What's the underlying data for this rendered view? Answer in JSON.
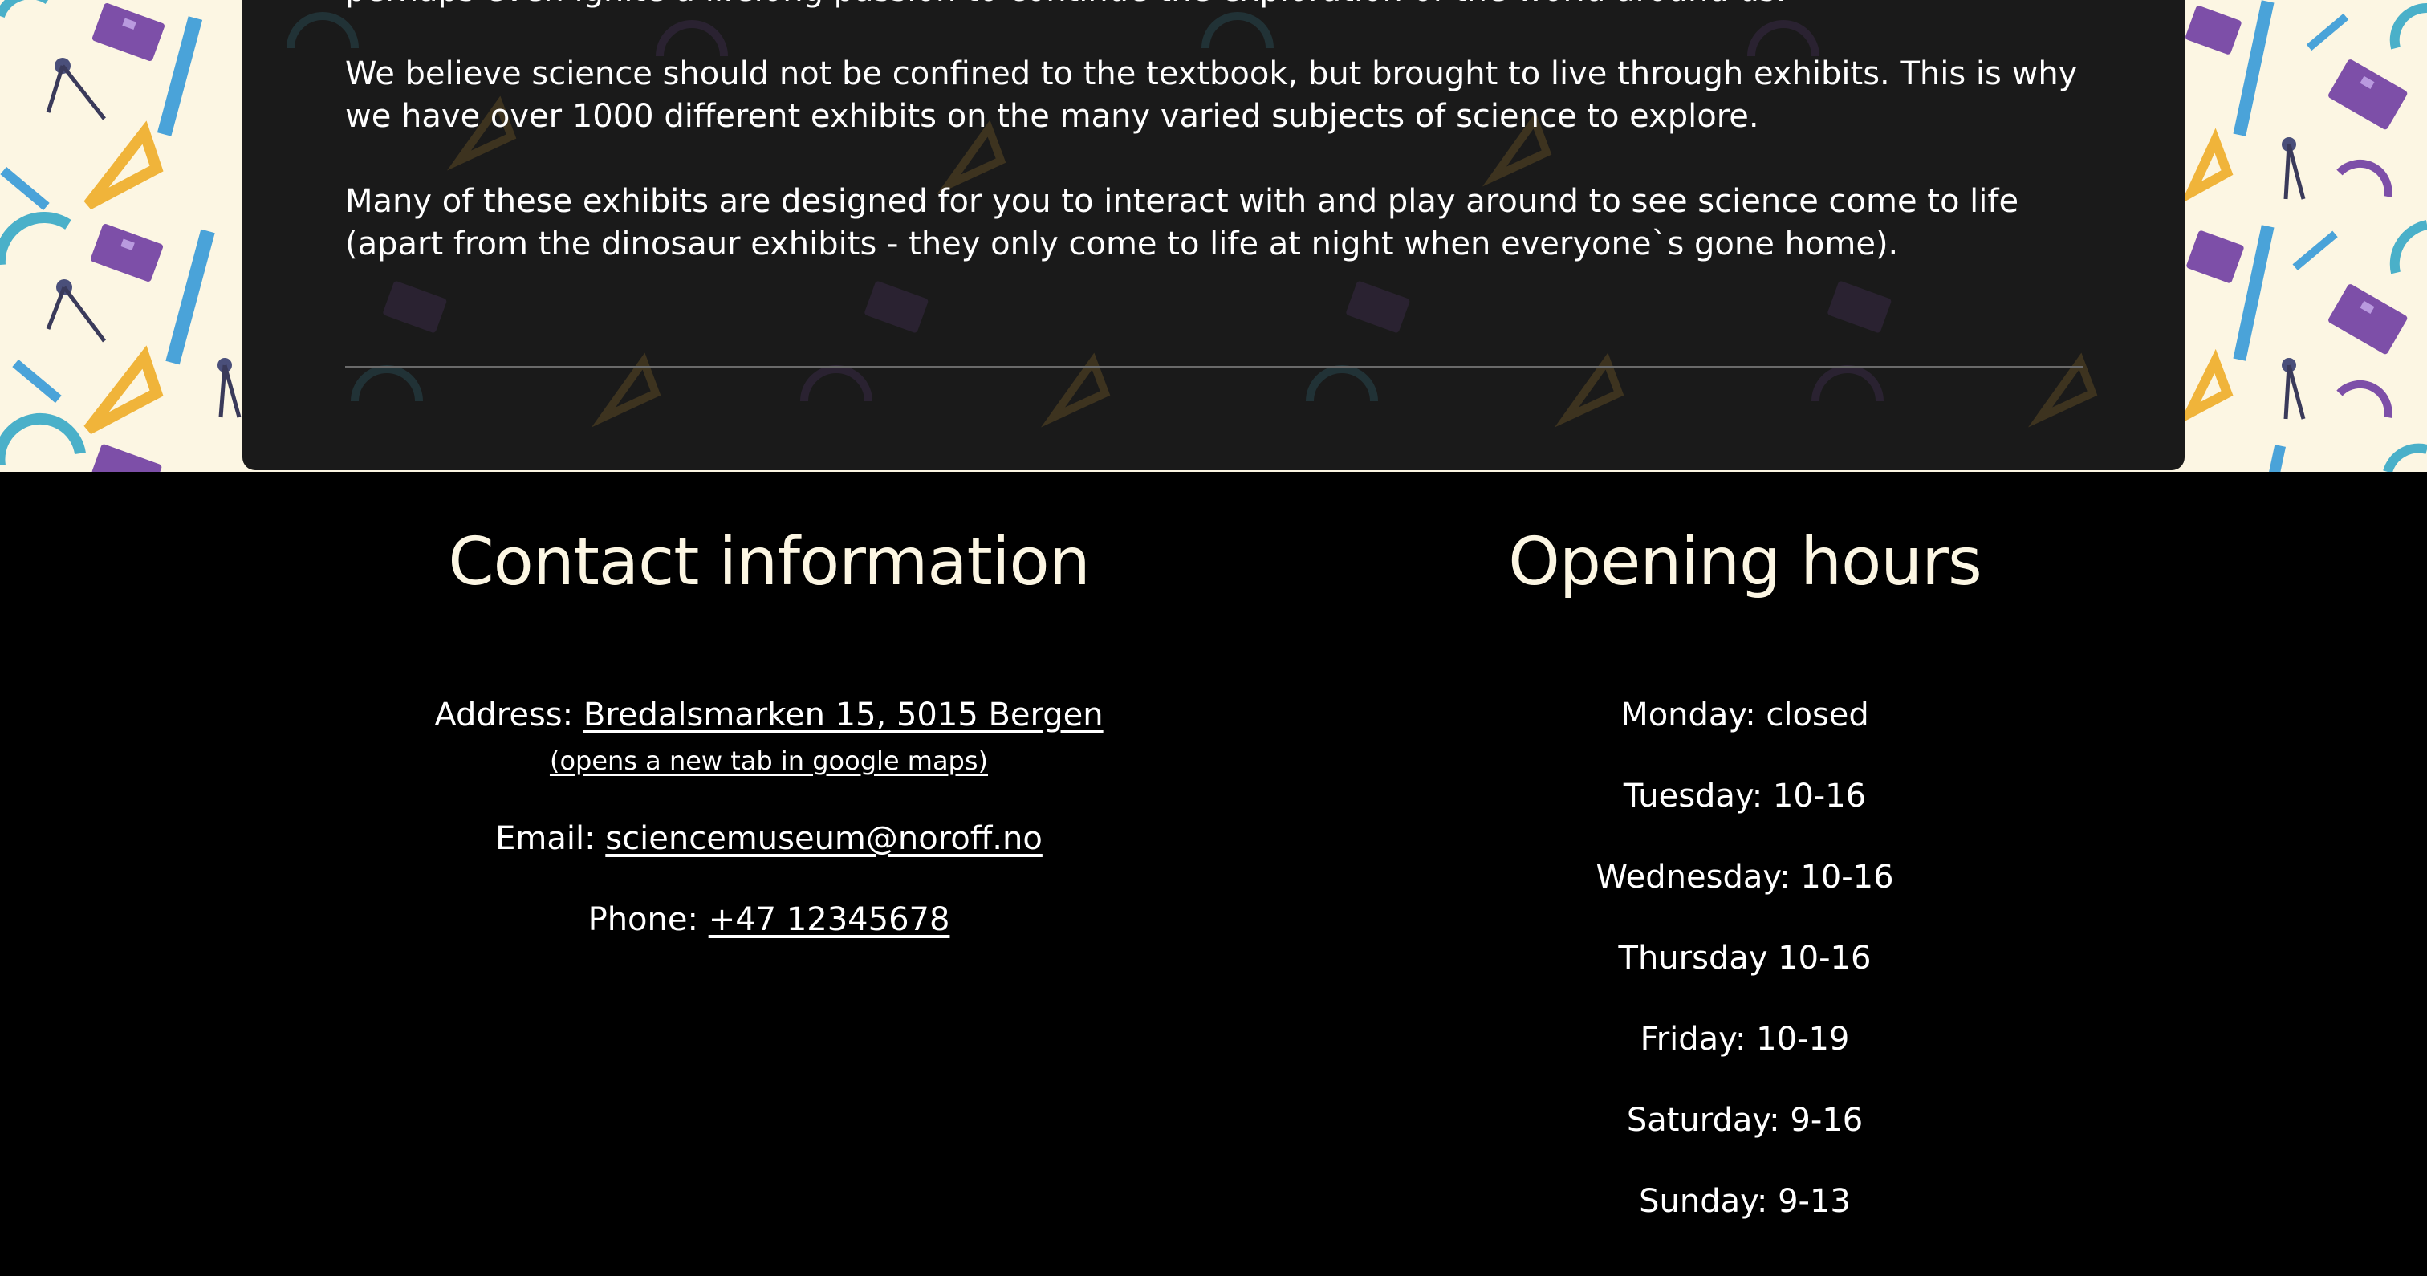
{
  "content": {
    "partial_line": "perhaps even ignite a lifelong passion to continue the exploration of the world around us.",
    "paragraph_1": "We believe science should not be confined to the textbook, but brought to live through exhibits. This is why we have over 1000 different exhibits on the many varied subjects of science to explore.",
    "paragraph_2": "Many of these exhibits are designed for you to interact with and play around to see science come to life (apart from the dinosaur exhibits - they only come to life at night when everyone`s gone home)."
  },
  "contact": {
    "title": "Contact information",
    "address_label": "Address:",
    "address_link": "Bredalsmarken 15, 5015 Bergen",
    "maps_note": "(opens a new tab in google maps)",
    "email_label": "Email:",
    "email_link": "sciencemuseum@noroff.no",
    "phone_label": "Phone:",
    "phone_link": "+47 12345678"
  },
  "hours": {
    "title": "Opening hours",
    "days": [
      "Monday: closed",
      "Tuesday: 10-16",
      "Wednesday: 10-16",
      "Thursday 10-16",
      "Friday: 10-19",
      "Saturday: 9-16",
      "Sunday: 9-13"
    ]
  },
  "colors": {
    "pattern_background": "#fcf6e3",
    "card_background": "#1a1a1a",
    "footer_background": "#000000",
    "heading": "#fcf6e3",
    "text": "#ffffff",
    "pattern_blue": "#4aa3d9",
    "pattern_purple": "#7d4fa8",
    "pattern_yellow": "#f0b43a"
  },
  "icons": [
    "ruler-icon",
    "protractor-icon",
    "triangle-ruler-icon",
    "notebook-icon",
    "compass-icon",
    "pencil-icon"
  ]
}
